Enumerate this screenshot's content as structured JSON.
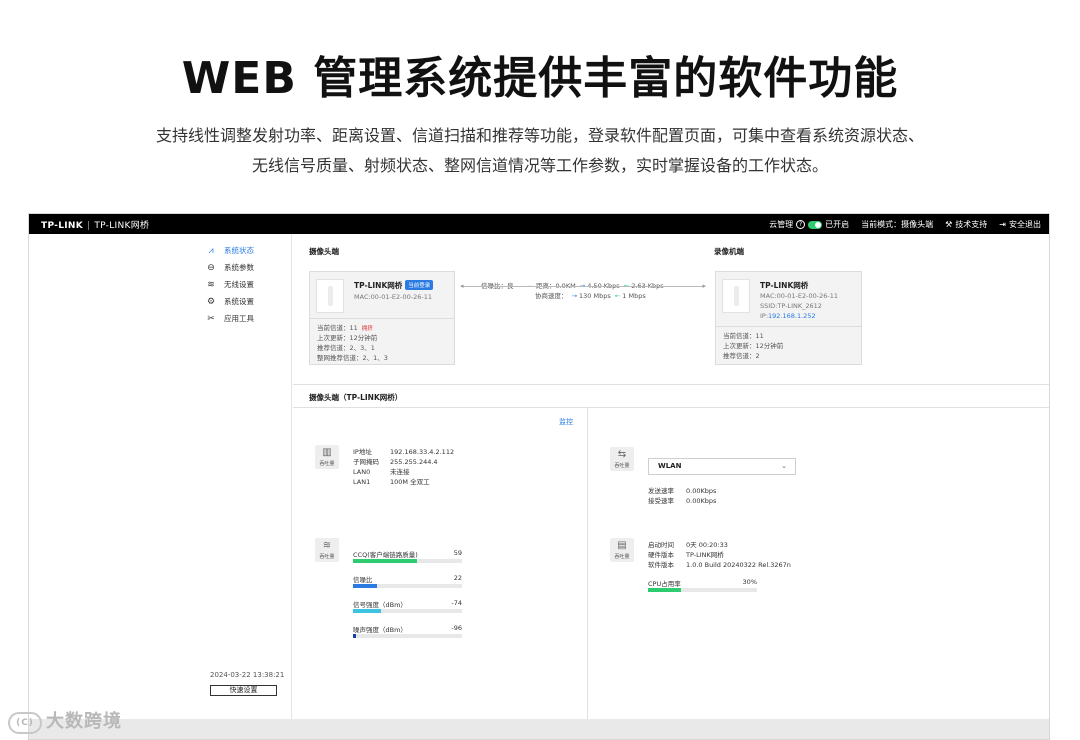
{
  "hero": {
    "title": "WEB 管理系统提供丰富的软件功能",
    "line1": "支持线性调整发射功率、距离设置、信道扫描和推荐等功能，登录软件配置页面，可集中查看系统资源状态、",
    "line2": "无线信号质量、射频状态、整网信道情况等工作参数，实时掌握设备的工作状态。"
  },
  "topbar": {
    "brand": "TP-LINK",
    "product": "TP-LINK网桥",
    "cloud_label": "云管理",
    "cloud_state": "已开启",
    "mode_label": "当前模式：摄像头端",
    "support": "技术支持",
    "logout": "安全退出"
  },
  "sidebar": {
    "items": [
      {
        "icon": "chart-icon",
        "label": "系统状态"
      },
      {
        "icon": "gauge-icon",
        "label": "系统参数"
      },
      {
        "icon": "wifi-icon",
        "label": "无线设置"
      },
      {
        "icon": "gear-icon",
        "label": "系统设置"
      },
      {
        "icon": "tools-icon",
        "label": "应用工具"
      }
    ],
    "datetime": "2024-03-22 13:38:21",
    "quick_setup": "快速设置"
  },
  "camera_side": {
    "title": "摄像头端",
    "name": "TP-LINK网桥",
    "badge": "当前登录",
    "mac": "MAC:00-01-E2-00-26-11",
    "channel": "当前信道：11",
    "channel_warn": "拥挤",
    "last_update": "上次更新：12分钟前",
    "recommended": "推荐信道：2、3、1",
    "network_recommended": "整网推荐信道：2、1、3"
  },
  "recorder_side": {
    "title": "录像机端",
    "name": "TP-LINK网桥",
    "mac": "MAC:00-01-E2-00-26-11",
    "ssid": "SSID:TP-LINK_2612",
    "ip_label": "IP:",
    "ip": "192.168.1.252",
    "channel": "当前信道：11",
    "last_update": "上次更新：12分钟前",
    "recommended": "推荐信道：2"
  },
  "link": {
    "snr_label": "信噪比：良",
    "distance": "距离：0.0KM",
    "up_rate": "4.50 Kbps",
    "down_rate": "2.63 Kbps",
    "negotiate_label": "协商速度：",
    "neg_up": "130 Mbps",
    "neg_down": "1 Mbps"
  },
  "detail": {
    "title": "摄像头端（TP-LINK网桥）",
    "monitor": "监控",
    "net_icon_caption": "吞吐量",
    "ip_k": "IP地址",
    "ip_v": "192.168.33.4.2.112",
    "mask_k": "子网掩码",
    "mask_v": "255.255.244.4",
    "lan0_k": "LAN0",
    "lan0_v": "未连接",
    "lan1_k": "LAN1",
    "lan1_v": "100M 全双工",
    "wlan_icon_caption": "吞吐量",
    "wlan_select": "WLAN",
    "send_k": "发送速率",
    "send_v": "0.00Kbps",
    "recv_k": "接受速率",
    "recv_v": "0.00Kbps",
    "signal_icon_caption": "吞吐量",
    "sys_icon_caption": "吞吐量",
    "uptime_k": "启动时间",
    "uptime_v": "0天 00:20:33",
    "hw_k": "硬件版本",
    "hw_v": "TP-LINK网桥",
    "sw_k": "软件版本",
    "sw_v": "1.0.0 Build 20240322 Rel.3267n",
    "cpu_label": "CPU占用率",
    "cpu_value": "30%",
    "cpu_fraction": 0.3
  },
  "metrics": [
    {
      "label": "CCQ(客户端链路质量)",
      "value": "59",
      "fraction": 0.59,
      "color": "#2ecc71"
    },
    {
      "label": "信噪比",
      "value": "22",
      "fraction": 0.22,
      "color": "#2a7ae2"
    },
    {
      "label": "信号强度（dBm）",
      "value": "-74",
      "fraction": 0.26,
      "color": "#3cc3e0"
    },
    {
      "label": "噪声强度（dBm）",
      "value": "-96",
      "fraction": 0.03,
      "color": "#1a3fa8"
    }
  ],
  "watermark": {
    "logo": "(C)",
    "text": "大数跨境"
  },
  "colors": {
    "accent": "#2a7ae2",
    "ok": "#2ecc71",
    "warn": "#e03131",
    "topbar": "#000000"
  }
}
